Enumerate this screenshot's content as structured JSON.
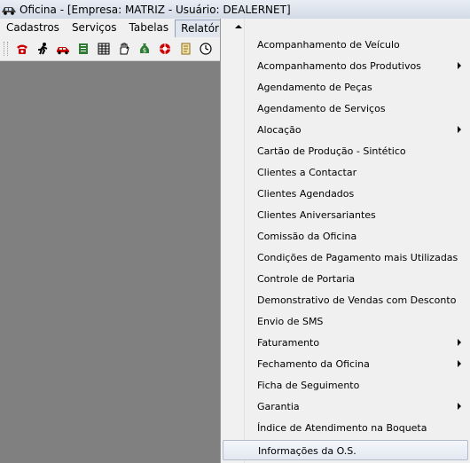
{
  "window": {
    "title": "Oficina - [Empresa: MATRIZ - Usuário: DEALERNET]",
    "app_icon": "car-icon"
  },
  "menubar": {
    "items": [
      "Cadastros",
      "Serviços",
      "Tabelas",
      "Relatórios"
    ],
    "active": "Relatórios"
  },
  "toolbar": {
    "icons": [
      "phone-icon",
      "running-man-icon",
      "red-car-icon",
      "document-icon",
      "grid-icon",
      "hand-icon",
      "money-bag-icon",
      "wheel-icon",
      "scroll-icon",
      "clock-icon"
    ]
  },
  "dropdown": {
    "items": [
      {
        "label": "Acompanhamento de Veículo",
        "submenu": false
      },
      {
        "label": "Acompanhamento dos Produtivos",
        "submenu": true
      },
      {
        "label": "Agendamento de Peças",
        "submenu": false
      },
      {
        "label": "Agendamento de Serviços",
        "submenu": false
      },
      {
        "label": "Alocação",
        "submenu": true
      },
      {
        "label": "Cartão de Produção - Sintético",
        "submenu": false
      },
      {
        "label": "Clientes a Contactar",
        "submenu": false
      },
      {
        "label": "Clientes Agendados",
        "submenu": false
      },
      {
        "label": "Clientes Aniversariantes",
        "submenu": false
      },
      {
        "label": "Comissão da Oficina",
        "submenu": false
      },
      {
        "label": "Condições de Pagamento mais Utilizadas",
        "submenu": false
      },
      {
        "label": "Controle de Portaria",
        "submenu": false
      },
      {
        "label": "Demonstrativo de Vendas com Desconto",
        "submenu": false
      },
      {
        "label": "Envio de SMS",
        "submenu": false
      },
      {
        "label": "Faturamento",
        "submenu": true
      },
      {
        "label": "Fechamento da Oficina",
        "submenu": true
      },
      {
        "label": "Ficha de Seguimento",
        "submenu": false
      },
      {
        "label": "Garantia",
        "submenu": true
      },
      {
        "label": "Índice de Atendimento na Boqueta",
        "submenu": false
      },
      {
        "label": "Informações da O.S.",
        "submenu": false
      }
    ],
    "highlighted": "Informações da O.S."
  },
  "colors": {
    "workspace": "#808080",
    "menu_bg": "#f0f0f0",
    "highlight_border": "#b3bccb"
  }
}
